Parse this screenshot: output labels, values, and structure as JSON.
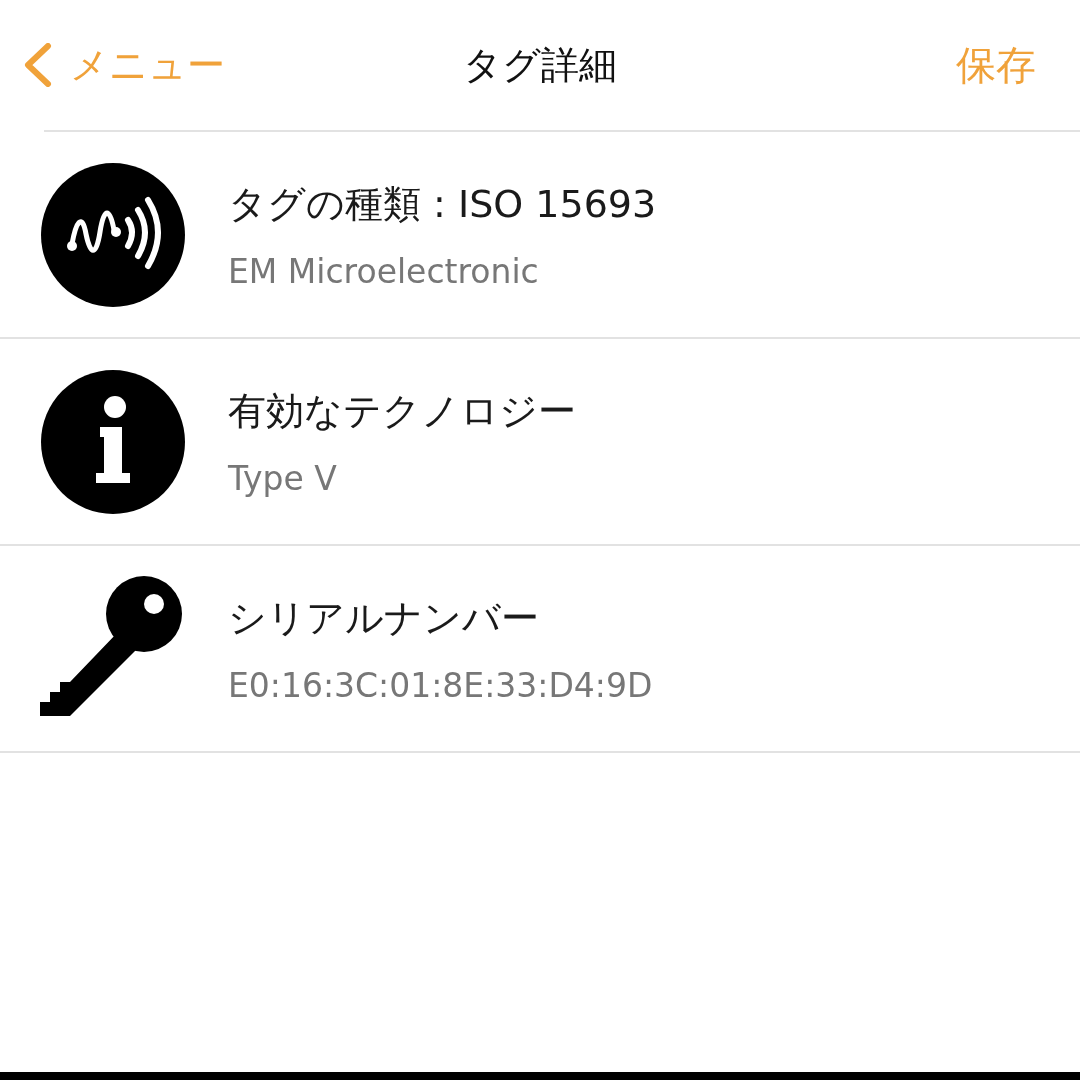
{
  "nav": {
    "back": "メニュー",
    "title": "タグ詳細",
    "action": "保存"
  },
  "rows": [
    {
      "kind": "nfc",
      "title": "タグの種類 : ISO 15693",
      "subtitle": "EM Microelectronic"
    },
    {
      "kind": "info",
      "title": "有効なテクノロジー",
      "subtitle": "Type V"
    },
    {
      "kind": "key",
      "title": "シリアルナンバー",
      "subtitle": "E0:16:3C:01:8E:33:D4:9D"
    }
  ]
}
